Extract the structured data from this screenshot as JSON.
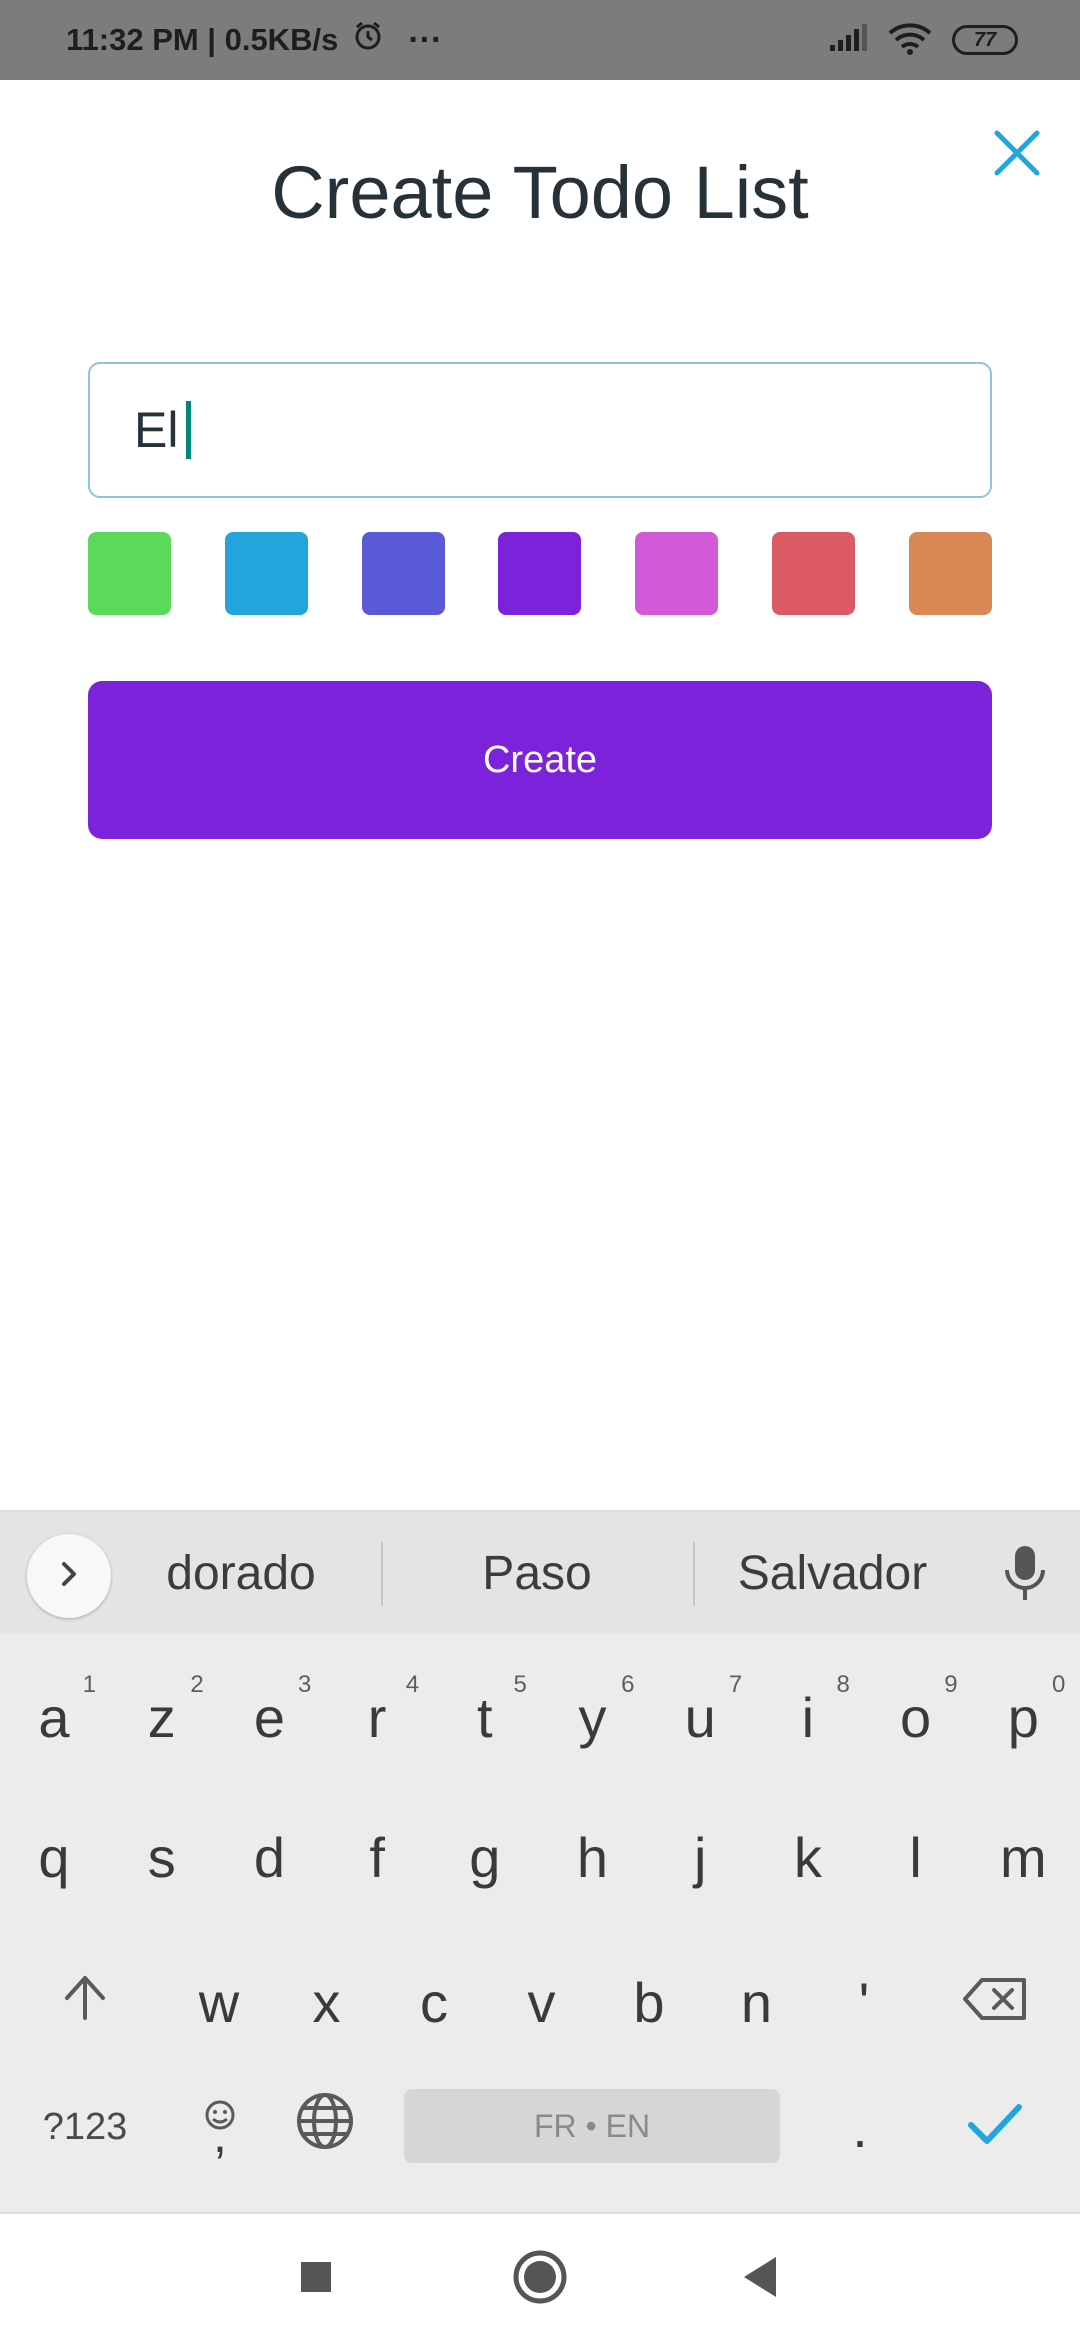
{
  "status_bar": {
    "time_speed": "11:32 PM | 0.5KB/s",
    "more": "···",
    "battery": "77",
    "icons": [
      "alarm-icon",
      "signal-icon",
      "wifi-icon",
      "battery-icon"
    ]
  },
  "dialog": {
    "title": "Create Todo List",
    "close_icon": "close-icon",
    "input_value": "El",
    "swatches": [
      {
        "name": "green",
        "color": "#5ad95a"
      },
      {
        "name": "blue",
        "color": "#23a5dc"
      },
      {
        "name": "indigo",
        "color": "#5a5ad7"
      },
      {
        "name": "purple",
        "color": "#7d22db"
      },
      {
        "name": "pink",
        "color": "#d25ad7"
      },
      {
        "name": "red",
        "color": "#dc5a64"
      },
      {
        "name": "orange",
        "color": "#d98755"
      }
    ],
    "create_label": "Create",
    "accent_color": "#7d22db"
  },
  "keyboard": {
    "suggestions": [
      "dorado",
      "Paso",
      "Salvador"
    ],
    "rows": [
      [
        {
          "k": "a",
          "h": "1"
        },
        {
          "k": "z",
          "h": "2"
        },
        {
          "k": "e",
          "h": "3"
        },
        {
          "k": "r",
          "h": "4"
        },
        {
          "k": "t",
          "h": "5"
        },
        {
          "k": "y",
          "h": "6"
        },
        {
          "k": "u",
          "h": "7"
        },
        {
          "k": "i",
          "h": "8"
        },
        {
          "k": "o",
          "h": "9"
        },
        {
          "k": "p",
          "h": "0"
        }
      ],
      [
        {
          "k": "q"
        },
        {
          "k": "s"
        },
        {
          "k": "d"
        },
        {
          "k": "f"
        },
        {
          "k": "g"
        },
        {
          "k": "h"
        },
        {
          "k": "j"
        },
        {
          "k": "k"
        },
        {
          "k": "l"
        },
        {
          "k": "m"
        }
      ],
      [
        {
          "k": "w"
        },
        {
          "k": "x"
        },
        {
          "k": "c"
        },
        {
          "k": "v"
        },
        {
          "k": "b"
        },
        {
          "k": "n"
        },
        {
          "k": "'"
        }
      ]
    ],
    "symbols_label": "?123",
    "comma": ",",
    "space_label": "FR • EN",
    "period": ".",
    "icons": [
      "shift-icon",
      "backspace-icon",
      "emoji-icon",
      "globe-icon",
      "done-check-icon",
      "mic-icon",
      "chevron-right-icon"
    ]
  },
  "nav_bar": {
    "icons": [
      "recents-square-icon",
      "home-circle-icon",
      "back-triangle-icon"
    ]
  }
}
